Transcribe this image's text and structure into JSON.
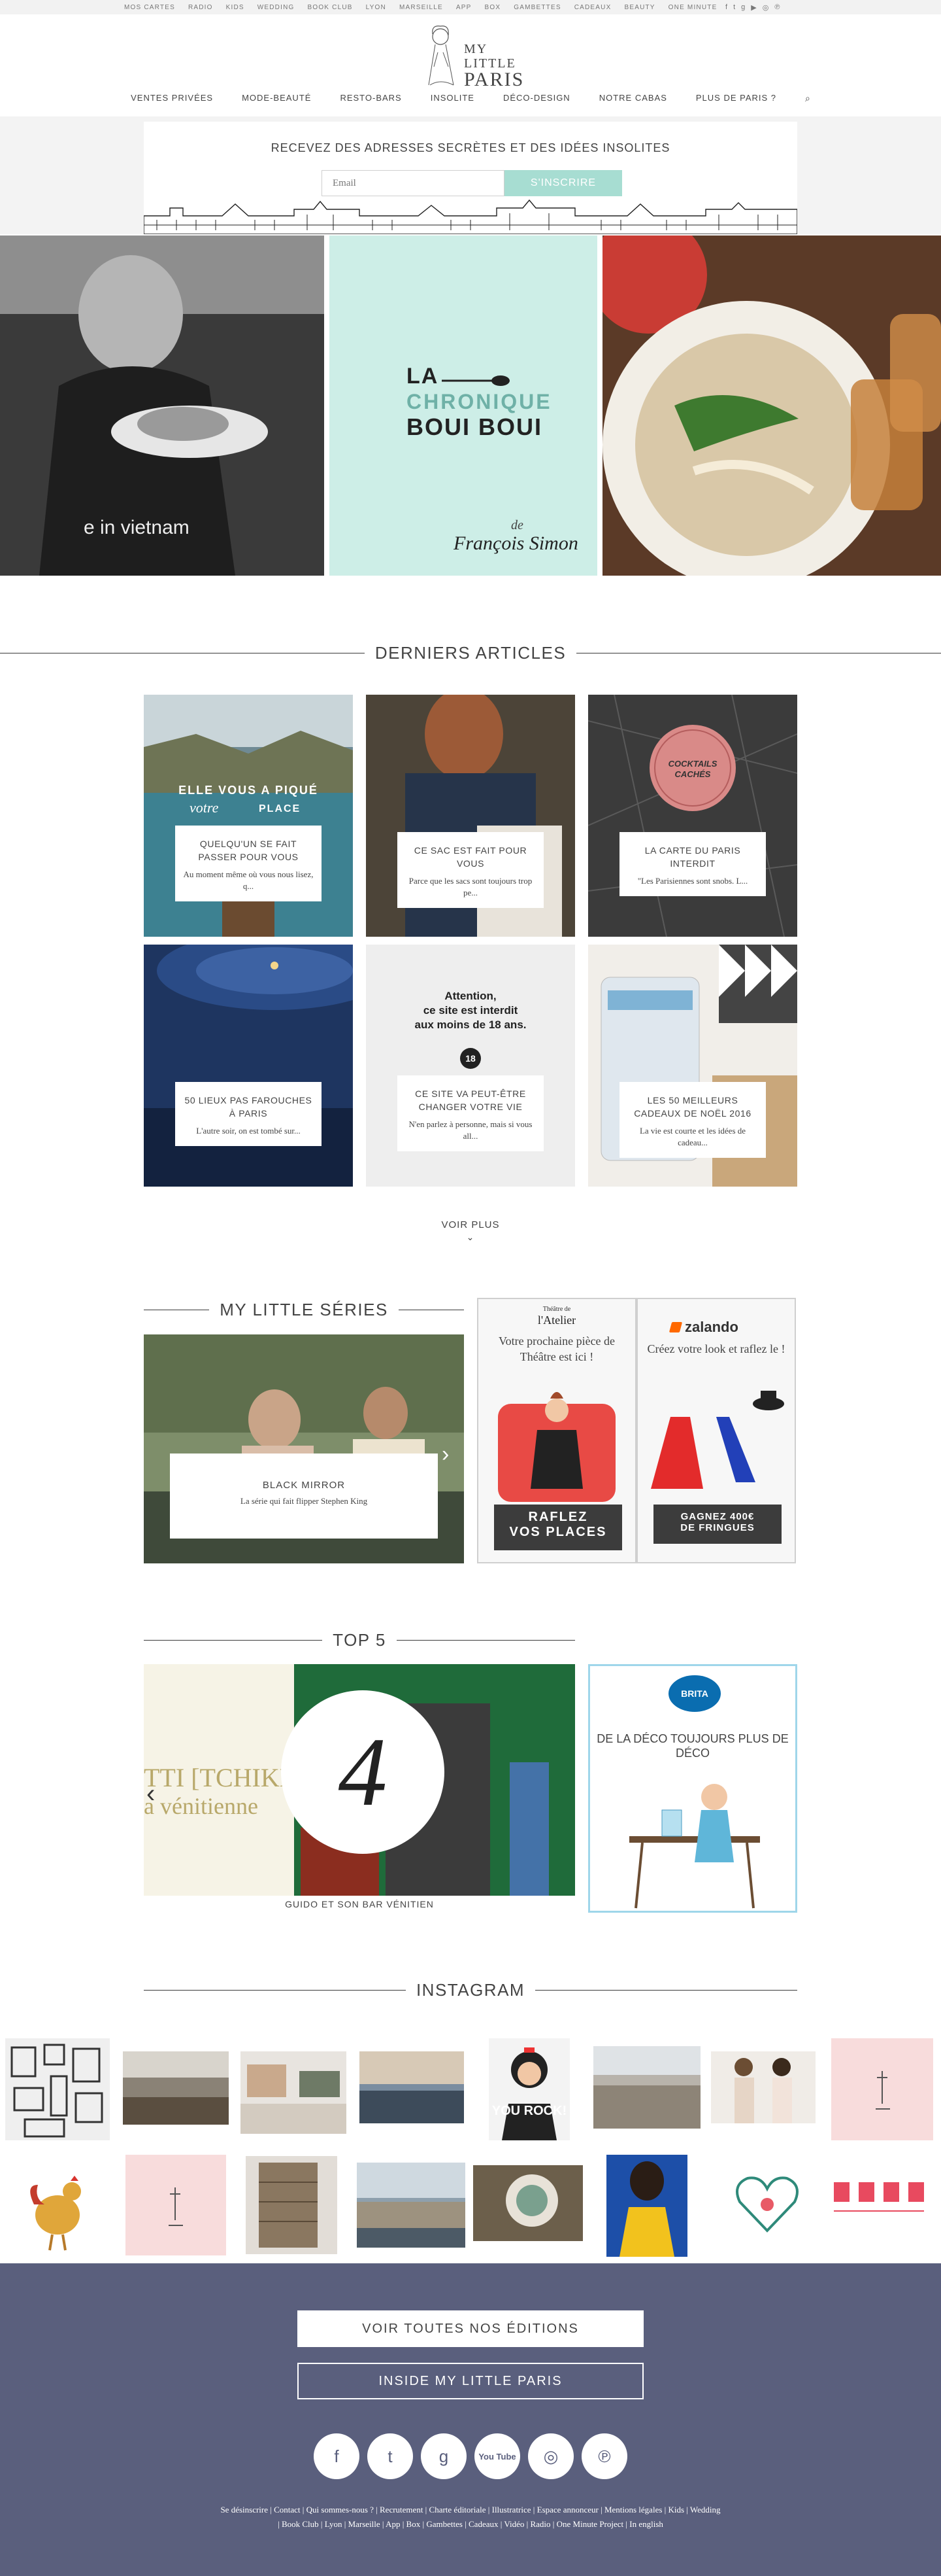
{
  "topbar": {
    "links": [
      "MOS CARTES",
      "RADIO",
      "KIDS",
      "WEDDING",
      "BOOK CLUB",
      "LYON",
      "MARSEILLE",
      "APP",
      "BOX",
      "GAMBETTES",
      "CADEAUX",
      "BEAUTY",
      "ONE MINUTE"
    ],
    "social": [
      "f",
      "t",
      "g",
      "▶",
      "◎",
      "℗"
    ]
  },
  "logo": {
    "line1": "MY",
    "line2": "LITTLE",
    "line3": "PARIS"
  },
  "nav": {
    "items": [
      "VENTES PRIVÉES",
      "MODE-BEAUTÉ",
      "RESTO-BARS",
      "INSOLITE",
      "DÉCO-DESIGN",
      "NOTRE CABAS",
      "PLUS DE PARIS ?"
    ],
    "search_icon": "⌕"
  },
  "newsletter": {
    "title": "RECEVEZ DES ADRESSES SECRÈTES ET DES IDÉES INSOLITES",
    "placeholder": "Email",
    "button": "S'INSCRIRE"
  },
  "hero": {
    "left_text": "e in vietnam",
    "chronique": {
      "la": "LA",
      "chronique": "CHRONIQUE",
      "bouibou": "BOUI BOUI",
      "de": "de",
      "author": "François Simon"
    }
  },
  "articles": {
    "heading": "DERNIERS ARTICLES",
    "items": [
      {
        "overlay_line1": "ELLE VOUS A PIQUÉ",
        "overlay_line2": "votre",
        "overlay_line3": "PLACE",
        "title": "QUELQU'UN SE FAIT PASSER POUR VOUS",
        "desc": "Au moment même où vous nous lisez, q..."
      },
      {
        "title": "CE SAC EST FAIT POUR VOUS",
        "desc": "Parce que les sacs sont toujours trop pe..."
      },
      {
        "overlay_line1": "COCKTAILS",
        "overlay_line2": "CACHÉS",
        "title": "LA CARTE DU PARIS INTERDIT",
        "desc": "\"Les Parisiennes sont snobs. L..."
      },
      {
        "title": "50 LIEUX PAS FAROUCHES À PARIS",
        "desc": "L'autre soir, on est tombé sur..."
      },
      {
        "overlay_line1": "Attention,",
        "overlay_line2": "ce site est interdit",
        "overlay_line3": "aux moins de 18 ans.",
        "badge": "18",
        "title": "CE SITE VA PEUT-ÊTRE CHANGER VOTRE VIE",
        "desc": "N'en parlez à personne, mais si vous all..."
      },
      {
        "title": "LES 50 MEILLEURS CADEAUX DE NOËL 2016",
        "desc": "La vie est courte et les idées de cadeau..."
      }
    ],
    "more": "VOIR PLUS",
    "more_icon": "⌄"
  },
  "series": {
    "heading": "MY LITTLE SÉRIES",
    "title": "BLACK MIRROR",
    "desc": "La série qui fait flipper Stephen King",
    "arrow": "›",
    "promo1": {
      "small": "Théâtre de",
      "brand": "l'Atelier",
      "text": "Votre prochaine pièce de Théâtre est ici !",
      "button_line1": "RAFLEZ",
      "button_line2": "VOS PLACES"
    },
    "promo2": {
      "brand": "zalando",
      "text": "Créez votre look et raflez le !",
      "button_line1": "GAGNEZ 400€",
      "button_line2": "DE FRINGUES"
    }
  },
  "top5": {
    "heading": "TOP 5",
    "number": "4",
    "side_text1": "TTI [TCHIKETI] :",
    "side_text2": "a vénitienne",
    "caption": "GUIDO ET SON BAR VÉNITIEN",
    "prev_icon": "‹",
    "brita_logo": "BRITA",
    "brita_text": "DE LA DÉCO TOUJOURS PLUS DE DÉCO"
  },
  "instagram": {
    "heading": "INSTAGRAM",
    "tile_texts": {
      "you_rock": "YOU ROCK!"
    }
  },
  "footer": {
    "btn1": "VOIR TOUTES NOS ÉDITIONS",
    "btn2": "INSIDE MY LITTLE PARIS",
    "social": [
      "f",
      "t",
      "g",
      "You Tube",
      "◎",
      "℗"
    ],
    "links_line1": "Se désinscrire  |  Contact  |  Qui sommes-nous ?  |  Recrutement  |  Charte éditoriale  |  Illustratrice  |  Espace annonceur  |  Mentions légales  |  Kids  |  Wedding",
    "links_line2": "|  Book Club  |  Lyon  |  Marseille  |  App  |  Box  |  Gambettes  |  Cadeaux  |  Vidéo  |  Radio  |  One Minute Project  |  In english"
  },
  "colors": {
    "mint": "#a7ddd2",
    "footer": "#5a5f7d",
    "chronique_teal": "#6fb1a7"
  }
}
